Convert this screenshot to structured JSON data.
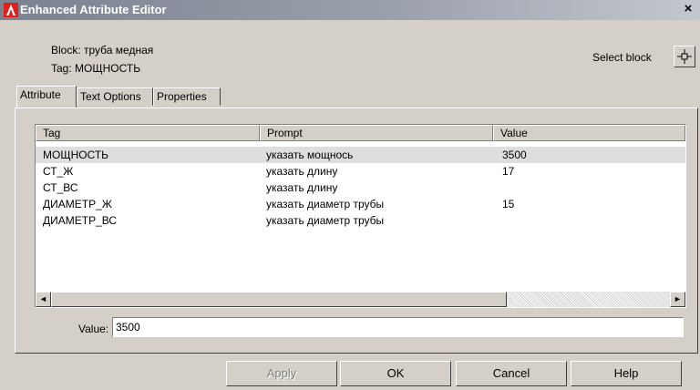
{
  "window": {
    "title": "Enhanced Attribute Editor",
    "close_symbol": "×"
  },
  "block": {
    "block_line": "Block: труба медная",
    "tag_line": "Tag: МОЩНОСТЬ"
  },
  "select_block": {
    "label": "Select block",
    "icon": "crosshair-pick-icon"
  },
  "tabs": [
    {
      "label": "Attribute",
      "active": true
    },
    {
      "label": "Text Options"
    },
    {
      "label": "Properties"
    }
  ],
  "table": {
    "columns": [
      "Tag",
      "Prompt",
      "Value"
    ],
    "rows": [
      {
        "tag": "МОЩНОСТЬ",
        "prompt": "указать мощнось",
        "value": "3500",
        "selected": true
      },
      {
        "tag": "СТ_Ж",
        "prompt": "указать длину",
        "value": "17"
      },
      {
        "tag": "СТ_ВС",
        "prompt": "указать длину",
        "value": ""
      },
      {
        "tag": "ДИАМЕТР_Ж",
        "prompt": "указать диаметр трубы",
        "value": "15"
      },
      {
        "tag": "ДИАМЕТР_ВС",
        "prompt": "указать диаметр трубы",
        "value": ""
      }
    ]
  },
  "scrollbar": {
    "left_arrow": "◄",
    "right_arrow": "►"
  },
  "value_field": {
    "label": "Value:",
    "value": "3500"
  },
  "buttons": {
    "apply": "Apply",
    "ok": "OK",
    "cancel": "Cancel",
    "help": "Help"
  },
  "colors": {
    "dialog_bg": "#d4d0c8",
    "selected_row": "#dedede",
    "autocad_red": "#e02020"
  }
}
